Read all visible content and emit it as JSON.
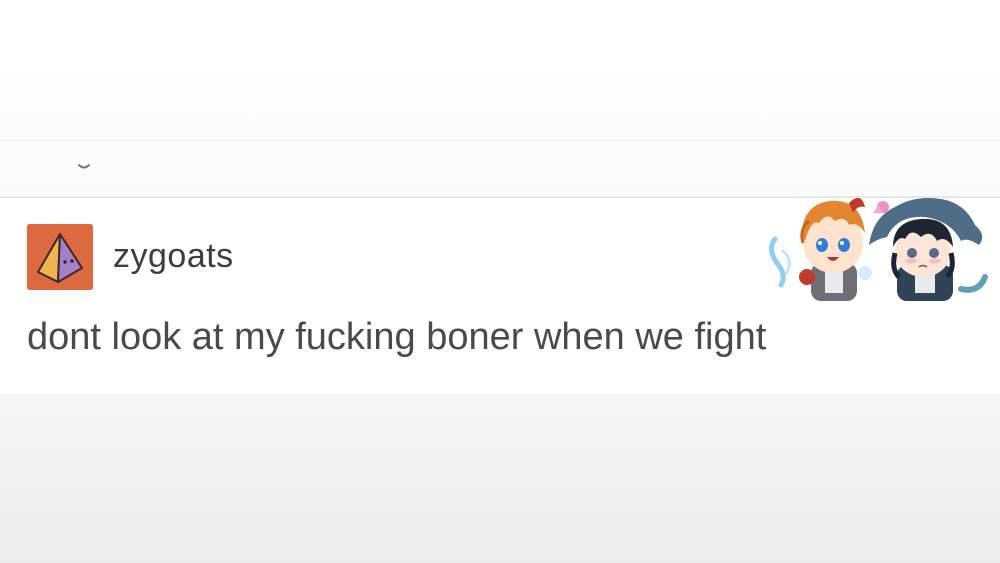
{
  "post": {
    "username": "zygoats",
    "text": "dont look at my fucking boner when we fight"
  },
  "avatar": {
    "icon": "pyramid-icon",
    "background": "#dd6a3e"
  },
  "stickers": {
    "icon": "chibi-characters-sticker"
  },
  "colors": {
    "page": "#ffffff",
    "text": "#4a4a4a",
    "divider": "#e8e8e8"
  }
}
